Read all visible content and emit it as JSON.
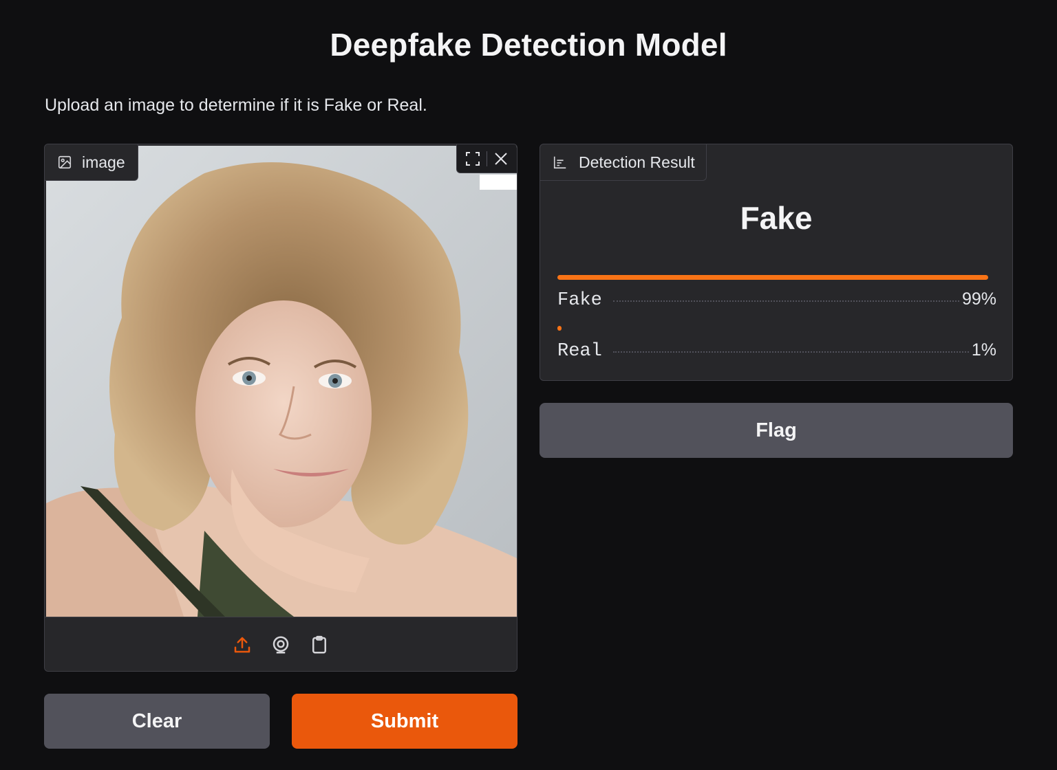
{
  "header": {
    "title": "Deepfake Detection Model",
    "description": "Upload an image to determine if it is Fake or Real."
  },
  "image_input": {
    "label": "image",
    "icons": {
      "label_icon": "image-icon",
      "fullscreen": "fullscreen-icon",
      "clear": "close-icon",
      "sources": [
        "upload-icon",
        "webcam-icon",
        "clipboard-icon"
      ]
    }
  },
  "result": {
    "label": "Detection Result",
    "label_icon": "bar-chart-icon",
    "prediction": "Fake",
    "confidences": [
      {
        "label": "Fake",
        "value": 0.99,
        "display": "99%"
      },
      {
        "label": "Real",
        "value": 0.01,
        "display": "1%"
      }
    ]
  },
  "buttons": {
    "clear": "Clear",
    "submit": "Submit",
    "flag": "Flag"
  },
  "colors": {
    "accent": "#ea580c",
    "bar": "#f97316",
    "background": "#0f0f11",
    "panel": "#27272a",
    "secondary_button": "#52525b"
  }
}
